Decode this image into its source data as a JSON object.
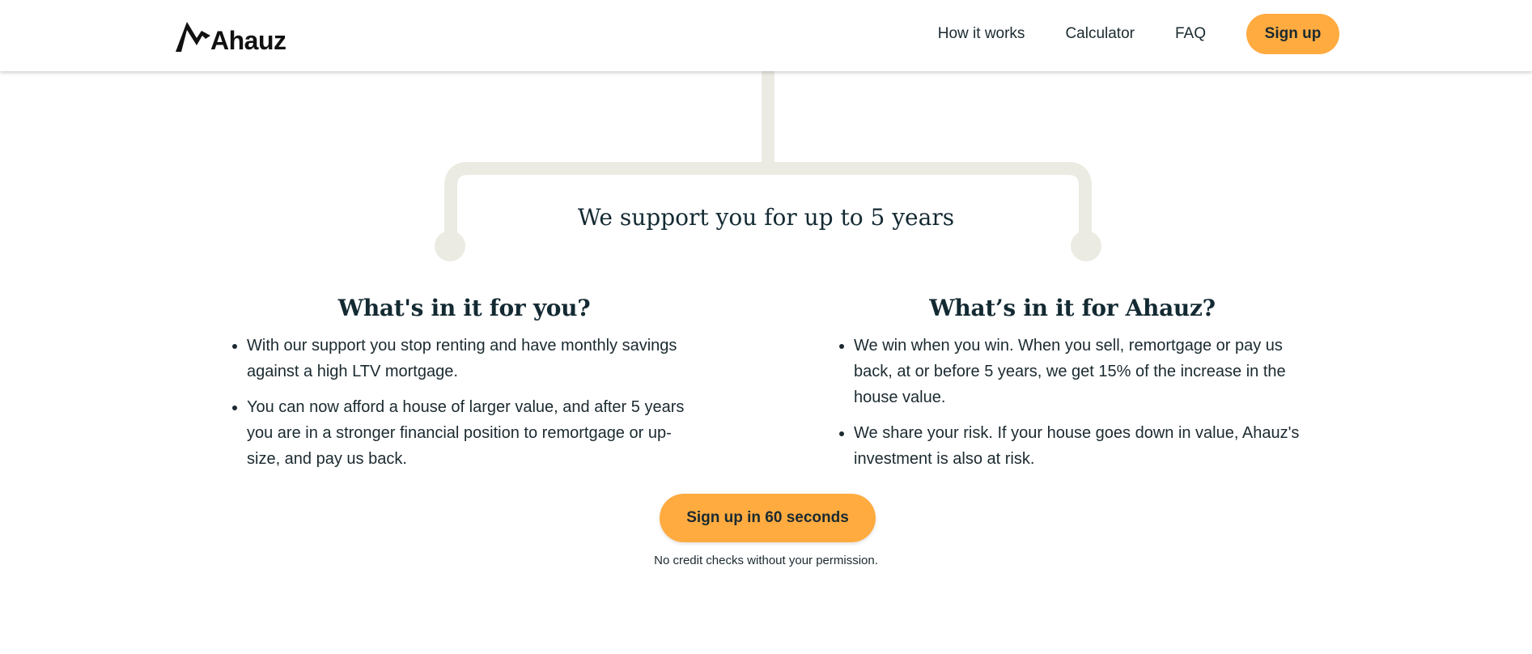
{
  "header": {
    "logo_text": "Ahauz",
    "nav": [
      {
        "label": "How it works"
      },
      {
        "label": "Calculator"
      },
      {
        "label": "FAQ"
      }
    ],
    "signup_label": "Sign up"
  },
  "support": {
    "title": "We support you for up to 5 years"
  },
  "columns": {
    "left": {
      "title": "What's in it for you?",
      "bullets": [
        "With our support you stop renting and have monthly savings against a high LTV mortgage.",
        "You can now afford a house of larger value, and after 5 years you are in a stronger financial position to remortgage or up-size, and pay us back."
      ]
    },
    "right": {
      "title": "What’s in it for Ahauz?",
      "bullets": [
        "We win when you win. When you sell, remortgage or pay us back, at or before 5 years, we get 15% of the increase in the house value.",
        "We share your risk. If your house goes down in value, Ahauz's investment is also at risk."
      ]
    }
  },
  "cta": {
    "label": "Sign up in 60 seconds",
    "disclaimer": "No credit checks without your permission."
  },
  "colors": {
    "accent": "#ffab40",
    "connector": "#ebebe3",
    "text": "#142a33"
  },
  "icons": {
    "logo": "house-roof-logo-icon"
  }
}
